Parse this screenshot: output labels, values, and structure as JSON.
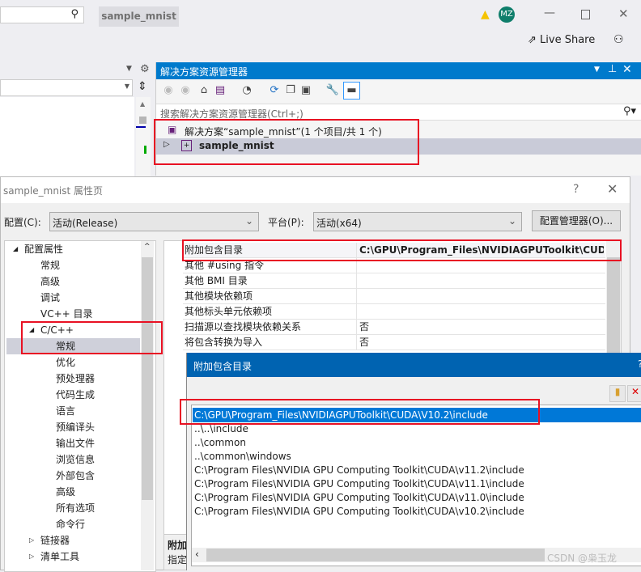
{
  "titlebar": {
    "project_tab": "sample_mnist",
    "avatar_initials": "MZ",
    "live_share": "Live Share"
  },
  "solution_explorer": {
    "title": "解决方案资源管理器",
    "search_placeholder": "搜索解决方案资源管理器(Ctrl+;)",
    "solution_label": "解决方案“sample_mnist”(1 个项目/共 1 个)",
    "project_label": "sample_mnist"
  },
  "properties_dialog": {
    "title": "sample_mnist 属性页",
    "help": "?",
    "config_label": "配置(C):",
    "config_value": "活动(Release)",
    "platform_label": "平台(P):",
    "platform_value": "活动(x64)",
    "config_manager": "配置管理器(O)...",
    "tree": [
      {
        "label": "配置属性",
        "level": 0,
        "expanded": true
      },
      {
        "label": "常规",
        "level": 1
      },
      {
        "label": "高级",
        "level": 1
      },
      {
        "label": "调试",
        "level": 1
      },
      {
        "label": "VC++ 目录",
        "level": 1
      },
      {
        "label": "C/C++",
        "level": 1,
        "expanded": true
      },
      {
        "label": "常规",
        "level": 2,
        "selected": true
      },
      {
        "label": "优化",
        "level": 2
      },
      {
        "label": "预处理器",
        "level": 2
      },
      {
        "label": "代码生成",
        "level": 2
      },
      {
        "label": "语言",
        "level": 2
      },
      {
        "label": "预编译头",
        "level": 2
      },
      {
        "label": "输出文件",
        "level": 2
      },
      {
        "label": "浏览信息",
        "level": 2
      },
      {
        "label": "外部包含",
        "level": 2
      },
      {
        "label": "高级",
        "level": 2
      },
      {
        "label": "所有选项",
        "level": 2
      },
      {
        "label": "命令行",
        "level": 2
      },
      {
        "label": "链接器",
        "level": 1,
        "collapsed": true
      },
      {
        "label": "清单工具",
        "level": 1,
        "collapsed": true
      }
    ],
    "properties": [
      {
        "name": "附加包含目录",
        "value": "C:\\GPU\\Program_Files\\NVIDIAGPUToolkit\\CUDA\\V"
      },
      {
        "name": "其他 #using 指令",
        "value": ""
      },
      {
        "name": "其他 BMI 目录",
        "value": ""
      },
      {
        "name": "其他模块依赖项",
        "value": ""
      },
      {
        "name": "其他标头单元依赖项",
        "value": ""
      },
      {
        "name": "扫描源以查找模块依赖关系",
        "value": "否"
      },
      {
        "name": "将包含转换为导入",
        "value": "否"
      }
    ],
    "desc_title": "附加",
    "desc_text": "指定"
  },
  "include_dialog": {
    "title": "附加包含目录",
    "items": [
      "C:\\GPU\\Program_Files\\NVIDIAGPUToolkit\\CUDA\\V10.2\\include",
      "..\\..\\include",
      "..\\common",
      "..\\common\\windows",
      "C:\\Program Files\\NVIDIA GPU Computing Toolkit\\CUDA\\v11.2\\include",
      "C:\\Program Files\\NVIDIA GPU Computing Toolkit\\CUDA\\v11.1\\include",
      "C:\\Program Files\\NVIDIA GPU Computing Toolkit\\CUDA\\v11.0\\include",
      "C:\\Program Files\\NVIDIA GPU Computing Toolkit\\CUDA\\v10.2\\include"
    ]
  },
  "watermark": "CSDN @枭玉龙",
  "colors": {
    "accent": "#007acc",
    "dialog_title": "#0063b1",
    "selection": "#0078d7",
    "highlight_box": "#e81123"
  }
}
